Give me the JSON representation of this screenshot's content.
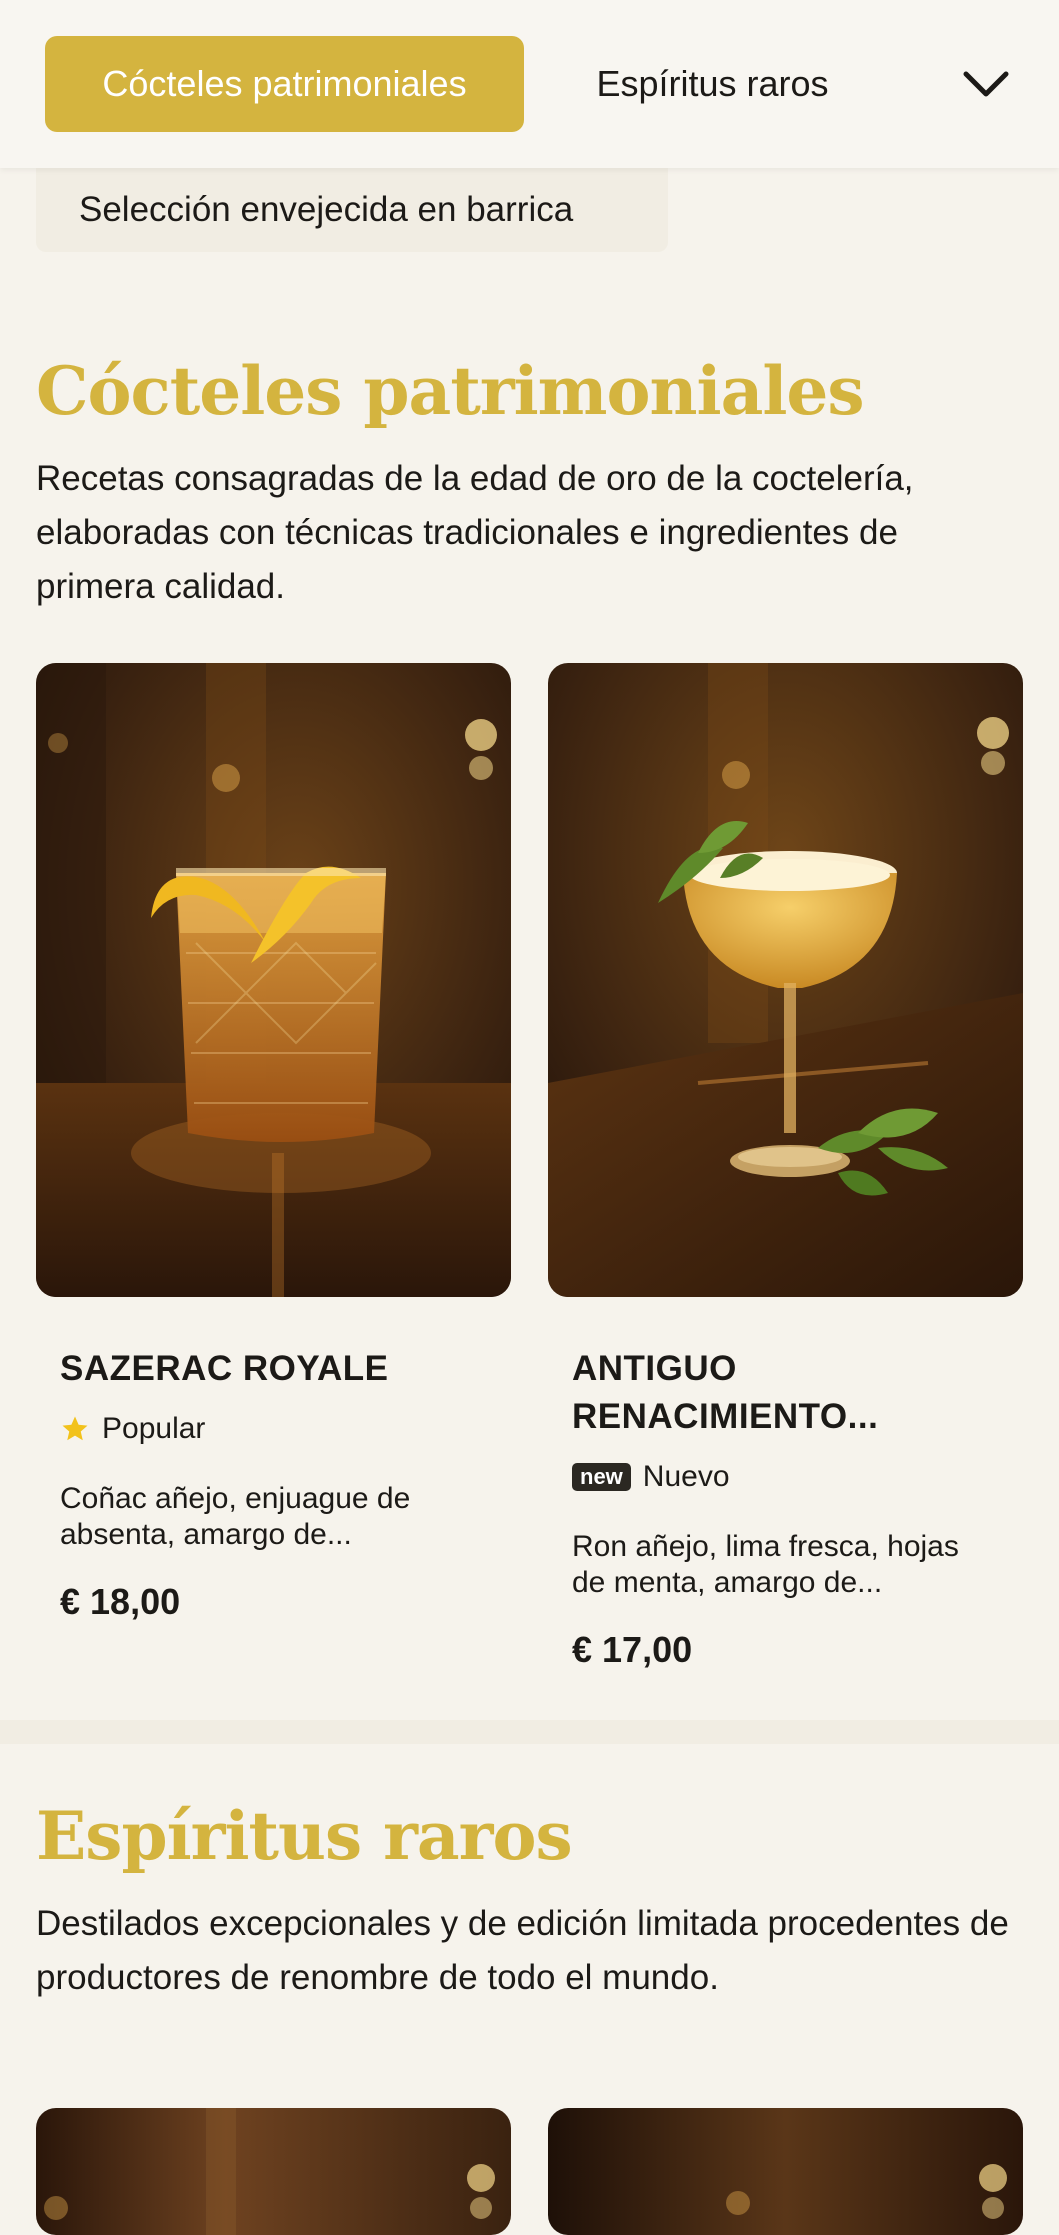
{
  "nav": {
    "active_tab": "Cócteles patrimoniales",
    "second_tab": "Espíritus raros",
    "dropdown_item": "Selección envejecida en barrica"
  },
  "section1": {
    "title": "Cócteles patrimoniales",
    "description": "Recetas consagradas de la edad de oro de la coctelería, elaboradas con técnicas tradicionales e ingredientes de primera calidad.",
    "cards": [
      {
        "name": "SAZERAC ROYALE",
        "badge": "Popular",
        "description": "Coñac añejo, enjuague de absenta, amargo de...",
        "price": "€ 18,00"
      },
      {
        "name": "ANTIGUO RENACIMIENTO...",
        "badge_tag": "new",
        "badge": "Nuevo",
        "description": "Ron añejo, lima fresca, hojas de menta, amargo de...",
        "price": "€ 17,00"
      }
    ]
  },
  "section2": {
    "title": "Espíritus raros",
    "description": "Destilados excepcionales y de edición limitada procedentes de productores de renombre de todo el mundo."
  },
  "colors": {
    "accent": "#d4b43f",
    "background": "#f6f3ec",
    "star": "#f2c21b"
  },
  "icons": {
    "dropdown": "chevron-down-icon",
    "popular": "star-icon"
  }
}
